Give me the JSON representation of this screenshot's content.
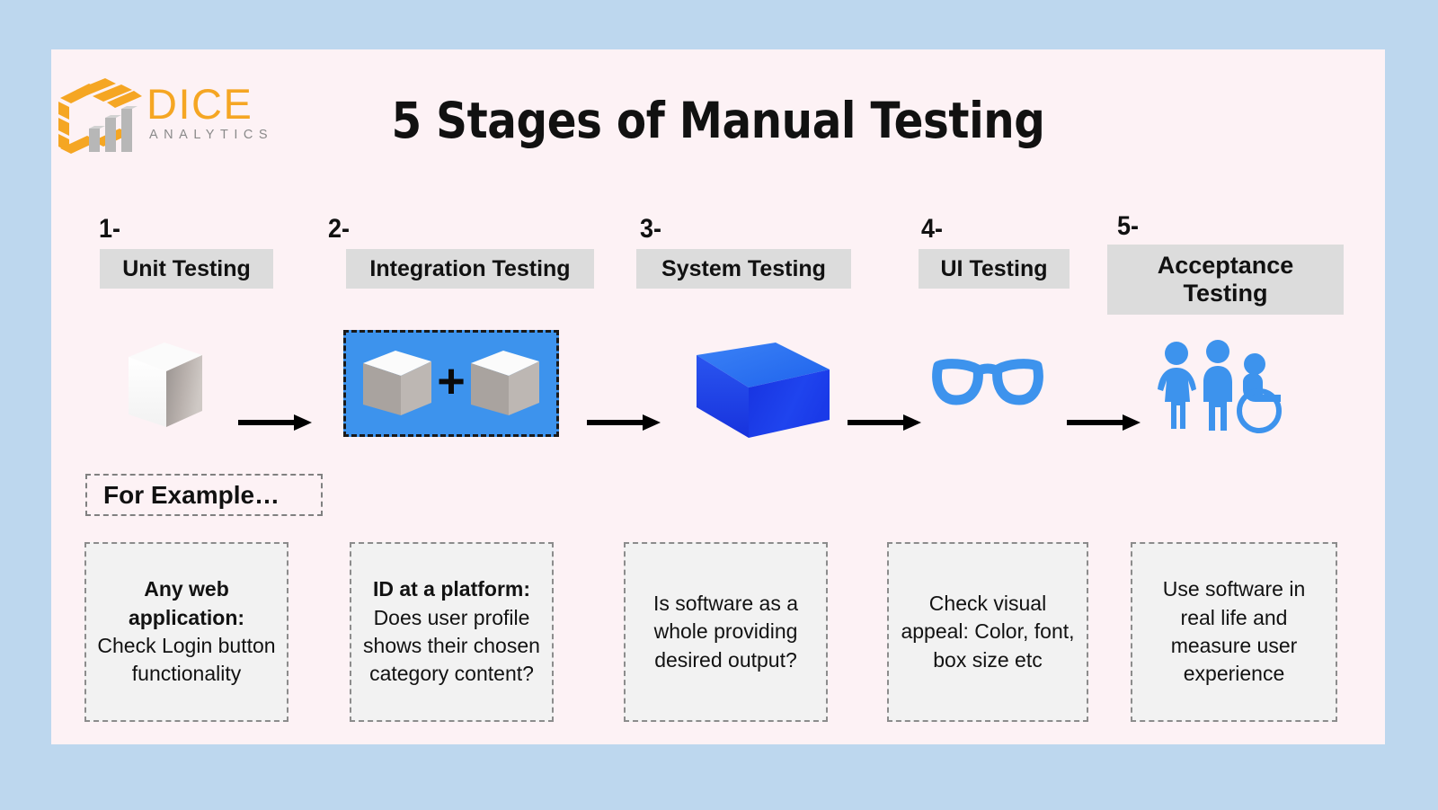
{
  "theme": {
    "outer_background": "#bdd7ee",
    "panel_background": "#fdf2f5",
    "label_chip_background": "#dcdcdc",
    "example_box_background": "#f2f2f2",
    "accent_blue": "#3d93ed",
    "logo_orange": "#f5a623",
    "logo_gray": "#8a8a8a"
  },
  "brand": {
    "name": "DICE",
    "subtitle": "ANALYTICS",
    "logo_icon": "dice-box-bar-chart-logo"
  },
  "header": {
    "title": "5 Stages of Manual Testing"
  },
  "stages": [
    {
      "number": "1-",
      "label": "Unit Testing",
      "icon": "white-cube-icon",
      "example_lead": "Any web application:",
      "example_body": "Check Login button functionality"
    },
    {
      "number": "2-",
      "label": "Integration Testing",
      "icon": "two-cubes-plus-icon",
      "plus": "+",
      "example_lead": "ID at a platform:",
      "example_body": "Does user profile shows their chosen category content?"
    },
    {
      "number": "3-",
      "label": "System Testing",
      "icon": "blue-3d-box-icon",
      "example_lead": "",
      "example_body": "Is software as a whole providing desired output?"
    },
    {
      "number": "4-",
      "label": "UI Testing",
      "icon": "eyeglasses-icon",
      "example_lead": "",
      "example_body": "Check visual appeal: Color, font, box size etc"
    },
    {
      "number": "5-",
      "label": "Acceptance Testing",
      "icon": "three-people-accessibility-icon",
      "example_lead": "",
      "example_body": "Use software in real life and measure user experience"
    }
  ],
  "for_example": {
    "text": "For Example…"
  },
  "arrows": {
    "icon": "right-arrow-icon",
    "count": 4
  }
}
